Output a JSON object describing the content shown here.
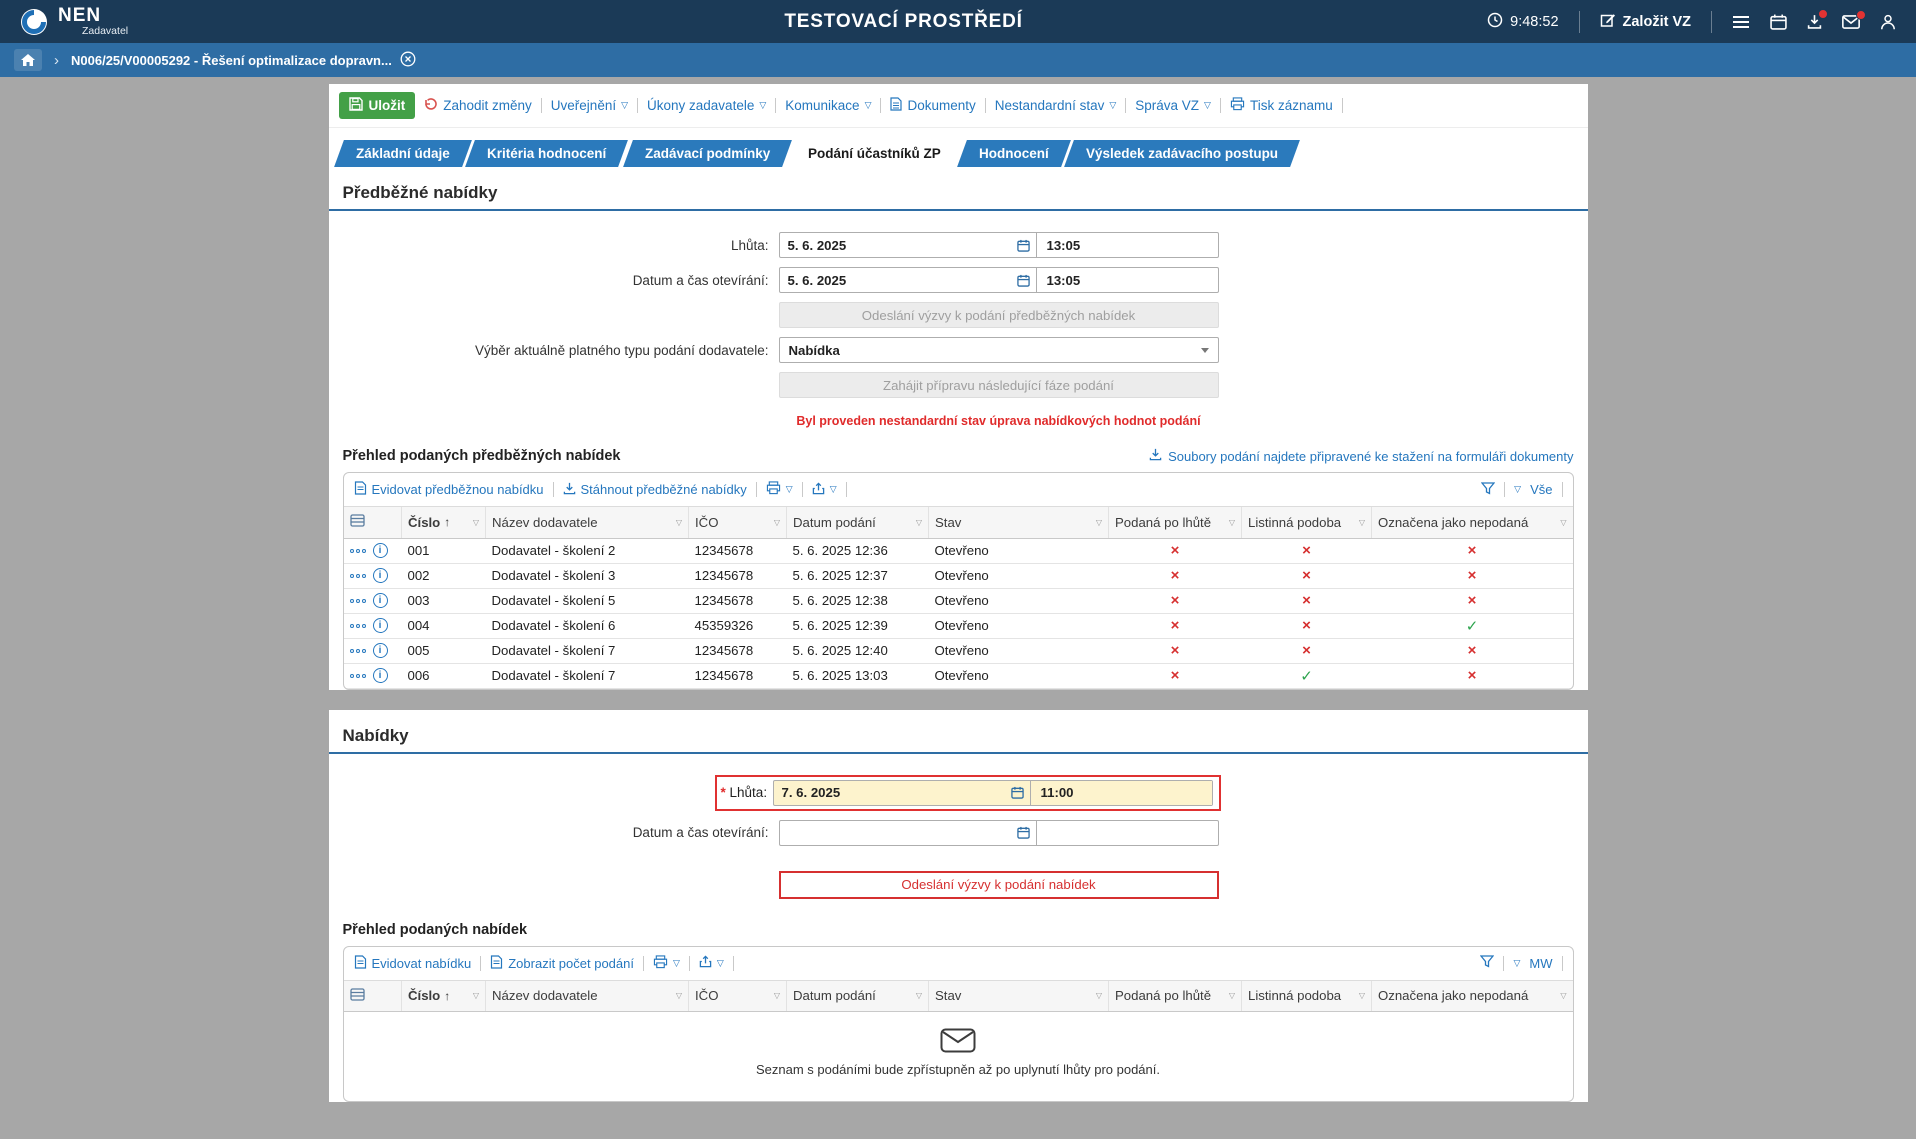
{
  "colors": {
    "header_navy": "#1b3a57",
    "breadcrumb_blue": "#2e6da4",
    "tab_blue": "#2b7abc",
    "link_blue": "#2577be",
    "save_green": "#43a047",
    "error_red": "#d63030",
    "required_yellow": "#fdf3cd"
  },
  "icons": {
    "caret_down": "▽",
    "sort_asc": "↑",
    "info_glyph": "i",
    "crumb_chevron": "›",
    "required": "*"
  },
  "marks": {
    "yes": "✓",
    "no": "×"
  },
  "header": {
    "logo_text": "NEN",
    "logo_subtitle": "Zadavatel",
    "environment_title": "TESTOVACÍ PROSTŘEDÍ",
    "time": "9:48:52",
    "create_vz": "Založit VZ"
  },
  "breadcrumb": {
    "item": "N006/25/V00005292 - Řešení optimalizace dopravn..."
  },
  "toolbar": {
    "save": "Uložit",
    "discard": "Zahodit změny",
    "publish": "Uveřejnění",
    "actions": "Úkony zadavatele",
    "communication": "Komunikace",
    "documents": "Dokumenty",
    "nonstandard": "Nestandardní stav",
    "admin": "Správa VZ",
    "print": "Tisk záznamu"
  },
  "tabs": [
    {
      "label": "Základní údaje",
      "cls": ""
    },
    {
      "label": "Kritéria hodnocení",
      "cls": ""
    },
    {
      "label": "Zadávací podmínky",
      "cls": ""
    },
    {
      "label": "Podání účastníků ZP",
      "cls": "active"
    },
    {
      "label": "Hodnocení",
      "cls": ""
    },
    {
      "label": "Výsledek zadávacího postupu",
      "cls": ""
    }
  ],
  "pre_offers": {
    "section_title": "Předběžné nabídky",
    "deadline_label": "Lhůta:",
    "deadline_date": "5. 6. 2025",
    "deadline_time": "13:05",
    "opening_label": "Datum a čas otevírání:",
    "opening_date": "5. 6. 2025",
    "opening_time": "13:05",
    "send_call_btn": "Odeslání výzvy k podání předběžných nabídek",
    "type_label": "Výběr aktuálně platného typu podání dodavatele:",
    "type_value": "Nabídka",
    "next_phase_btn": "Zahájit přípravu následující fáze podání",
    "warning": "Byl proveden nestandardní stav úprava nabídkových hodnot podání",
    "table_title": "Přehled podaných předběžných nabídek",
    "files_link": "Soubory podání najdete připravené ke stažení na formuláři dokumenty"
  },
  "grid_headers": {
    "cislo": "Číslo",
    "nazev": "Název dodavatele",
    "ico": "IČO",
    "datum": "Datum podání",
    "stav": "Stav",
    "po_lhute": "Podaná po lhůtě",
    "listinna": "Listinná podoba",
    "nepodana": "Označena jako nepodaná"
  },
  "pre_table": {
    "register": "Evidovat předběžnou nabídku",
    "download": "Stáhnout předběžné nabídky",
    "filter_value": "Vše",
    "rows": [
      {
        "cislo": "001",
        "nazev": "Dodavatel - školení 2",
        "ico": "12345678",
        "datum": "5. 6. 2025 12:36",
        "stav": "Otevřeno",
        "po_lhute": false,
        "listinna": false,
        "nepodana": false
      },
      {
        "cislo": "002",
        "nazev": "Dodavatel - školení 3",
        "ico": "12345678",
        "datum": "5. 6. 2025 12:37",
        "stav": "Otevřeno",
        "po_lhute": false,
        "listinna": false,
        "nepodana": false
      },
      {
        "cislo": "003",
        "nazev": "Dodavatel - školení 5",
        "ico": "12345678",
        "datum": "5. 6. 2025 12:38",
        "stav": "Otevřeno",
        "po_lhute": false,
        "listinna": false,
        "nepodana": false
      },
      {
        "cislo": "004",
        "nazev": "Dodavatel - školení 6",
        "ico": "45359326",
        "datum": "5. 6. 2025 12:39",
        "stav": "Otevřeno",
        "po_lhute": false,
        "listinna": false,
        "nepodana": true
      },
      {
        "cislo": "005",
        "nazev": "Dodavatel - školení 7",
        "ico": "12345678",
        "datum": "5. 6. 2025 12:40",
        "stav": "Otevřeno",
        "po_lhute": false,
        "listinna": false,
        "nepodana": false
      },
      {
        "cislo": "006",
        "nazev": "Dodavatel - školení 7",
        "ico": "12345678",
        "datum": "5. 6. 2025 13:03",
        "stav": "Otevřeno",
        "po_lhute": false,
        "listinna": true,
        "nepodana": false
      }
    ]
  },
  "offers": {
    "section_title": "Nabídky",
    "deadline_label": "Lhůta:",
    "deadline_date": "7. 6. 2025",
    "deadline_time": "11:00",
    "opening_label": "Datum a čas otevírání:",
    "opening_date": "",
    "opening_time": "",
    "send_call_btn": "Odeslání výzvy k podání nabídek",
    "table_title": "Přehled podaných nabídek"
  },
  "offers_table": {
    "register": "Evidovat nabídku",
    "count": "Zobrazit počet podání",
    "filter_value": "MW",
    "empty_text": "Seznam s podáními bude zpřístupněn až po uplynutí lhůty pro podání."
  }
}
